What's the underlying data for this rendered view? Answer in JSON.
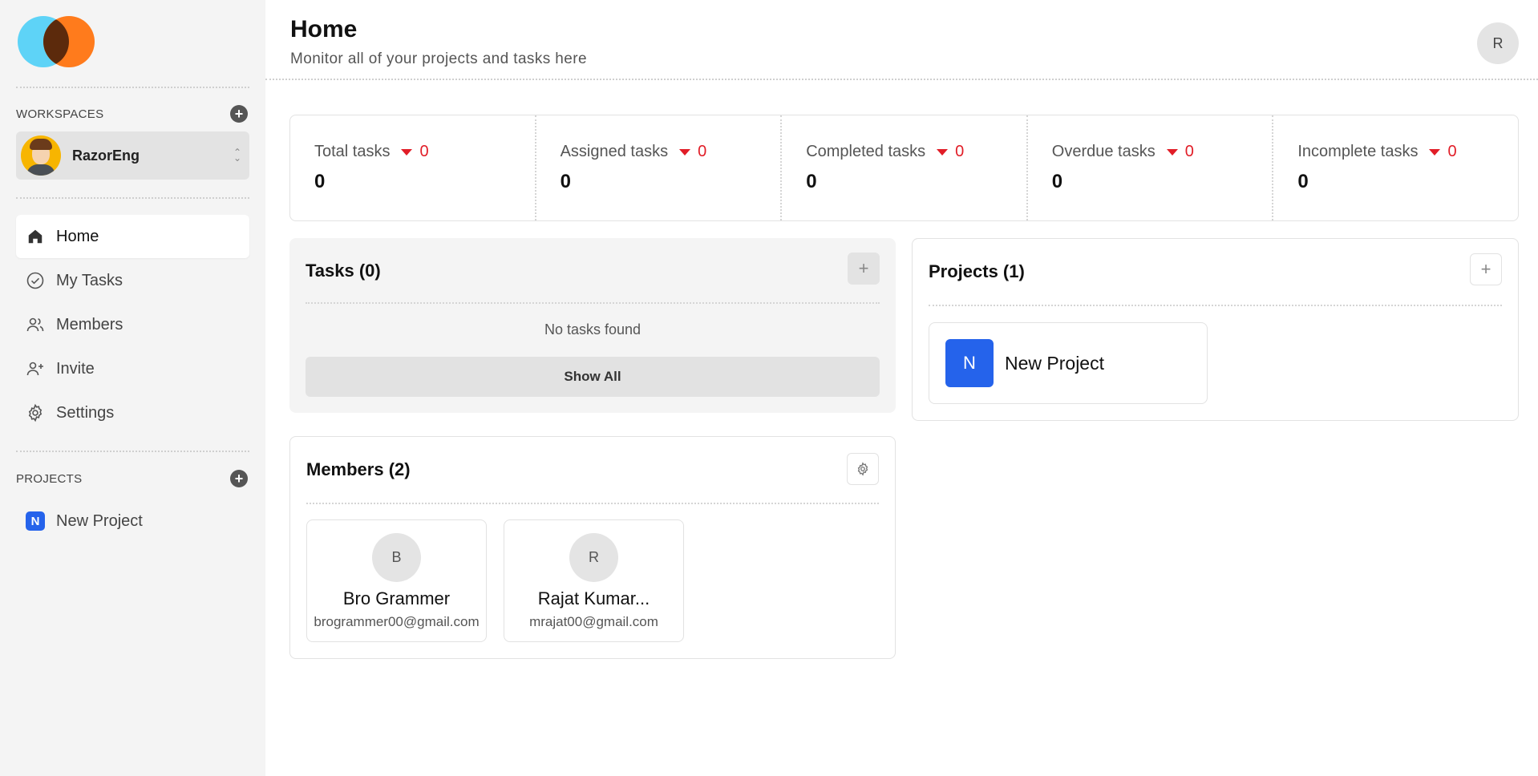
{
  "sidebar": {
    "workspaces_label": "WORKSPACES",
    "workspace_name": "RazorEng",
    "nav": [
      {
        "label": "Home",
        "icon": "home-icon"
      },
      {
        "label": "My Tasks",
        "icon": "check-circle-icon"
      },
      {
        "label": "Members",
        "icon": "users-icon"
      },
      {
        "label": "Invite",
        "icon": "user-plus-icon"
      },
      {
        "label": "Settings",
        "icon": "gear-icon"
      }
    ],
    "projects_label": "PROJECTS",
    "projects": [
      {
        "initial": "N",
        "name": "New Project"
      }
    ]
  },
  "header": {
    "title": "Home",
    "subtitle": "Monitor all of your projects and tasks here",
    "user_initial": "R"
  },
  "stats": [
    {
      "label": "Total tasks",
      "delta": "0",
      "value": "0"
    },
    {
      "label": "Assigned tasks",
      "delta": "0",
      "value": "0"
    },
    {
      "label": "Completed tasks",
      "delta": "0",
      "value": "0"
    },
    {
      "label": "Overdue tasks",
      "delta": "0",
      "value": "0"
    },
    {
      "label": "Incomplete tasks",
      "delta": "0",
      "value": "0"
    }
  ],
  "tasks": {
    "title": "Tasks (0)",
    "add_symbol": "+",
    "empty_text": "No tasks found",
    "show_all_label": "Show All"
  },
  "projects": {
    "title": "Projects (1)",
    "add_symbol": "+",
    "items": [
      {
        "initial": "N",
        "name": "New Project"
      }
    ]
  },
  "members": {
    "title": "Members (2)",
    "items": [
      {
        "initial": "B",
        "name": "Bro Grammer",
        "email": "brogrammer00@gmail.com"
      },
      {
        "initial": "R",
        "name": "Rajat Kumar...",
        "email": "mrajat00@gmail.com"
      }
    ]
  },
  "colors": {
    "accent_blue": "#2563eb",
    "delta_red": "#e11d27",
    "sidebar_bg": "#f4f4f4"
  }
}
